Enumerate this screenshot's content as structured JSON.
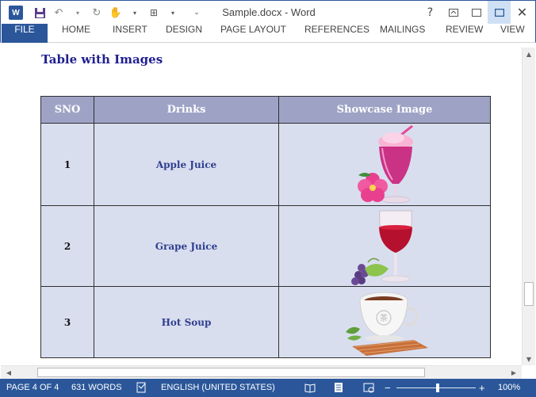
{
  "window": {
    "title": "Sample.docx - Word",
    "controls": [
      "?",
      "restore-ribbon",
      "maximize",
      "close"
    ]
  },
  "qat": {
    "app_icon_letter": "W"
  },
  "ribbon": {
    "tabs": [
      "FILE",
      "HOME",
      "INSERT",
      "DESIGN",
      "PAGE LAYOUT",
      "REFERENCES",
      "MAILINGS",
      "REVIEW",
      "VIEW"
    ]
  },
  "document": {
    "heading": "Table with Images",
    "table": {
      "headers": [
        "SNO",
        "Drinks",
        "Showcase Image"
      ],
      "rows": [
        {
          "sno": "1",
          "drink": "Apple Juice",
          "image": "pink-cocktail-with-hibiscus"
        },
        {
          "sno": "2",
          "drink": "Grape Juice",
          "image": "red-wine-glass-with-grapes"
        },
        {
          "sno": "3",
          "drink": "Hot Soup",
          "image": "tea-cup-on-mat"
        }
      ]
    }
  },
  "statusbar": {
    "page": "PAGE 4 OF 4",
    "words": "631 WORDS",
    "language": "ENGLISH (UNITED STATES)",
    "zoom": "100%"
  },
  "colors": {
    "brand": "#2b579a",
    "table_header": "#9ea3c6",
    "table_cell": "#d9deef",
    "heading": "#1f1f8f"
  }
}
